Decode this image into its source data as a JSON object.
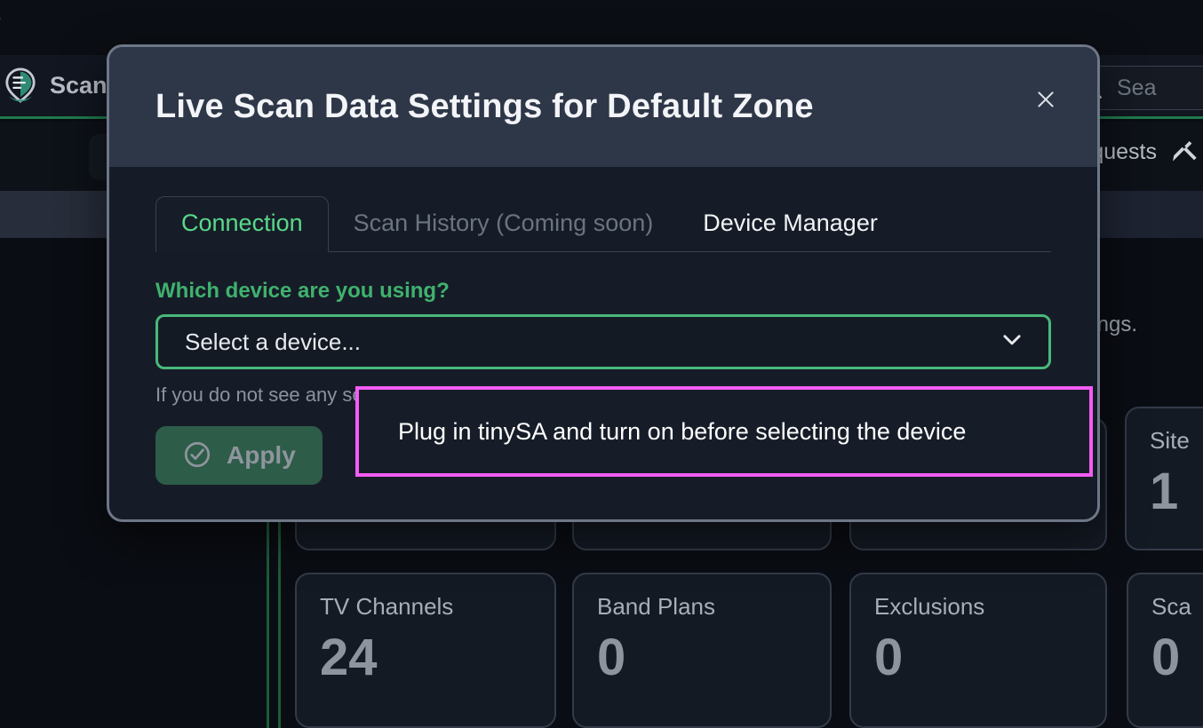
{
  "background": {
    "top_strip_text": "e",
    "brand": {
      "name": "ScanP",
      "logo_icon": "scan-pin-logo-icon"
    },
    "search": {
      "icon": "search-icon",
      "placeholder": "Sea"
    },
    "subnav": {
      "right_label": "quests",
      "right_icon": "tools-icon"
    },
    "body_text": "ngs.",
    "cards_upper": [
      {
        "title": "",
        "value": ""
      },
      {
        "title": "",
        "value": ""
      },
      {
        "title": "",
        "value": ""
      }
    ],
    "card_site": {
      "title": "Site",
      "value": "1"
    },
    "cards_lower": [
      {
        "title": "TV Channels",
        "value": "24"
      },
      {
        "title": "Band Plans",
        "value": "0"
      },
      {
        "title": "Exclusions",
        "value": "0"
      },
      {
        "title": "Sca",
        "value": "0"
      }
    ]
  },
  "modal": {
    "title": "Live Scan Data Settings for Default Zone",
    "close_icon": "close-icon",
    "tabs": [
      {
        "label": "Connection",
        "state": "active"
      },
      {
        "label": "Scan History (Coming soon)",
        "state": "disabled"
      },
      {
        "label": "Device Manager",
        "state": "plain"
      }
    ],
    "field": {
      "label": "Which device are you using?",
      "selected_value": "Select a device...",
      "chevron_icon": "chevron-down-icon",
      "helper": "If you do not see any selectable options, please register a new device to your account."
    },
    "apply": {
      "label": "Apply",
      "icon": "circle-check-icon"
    },
    "callout": {
      "text": "Plug in tinySA and turn on before selecting the device"
    }
  },
  "colors": {
    "accent_green": "#49b87b",
    "tab_active_green": "#58d98a",
    "callout_magenta": "#f45cf4",
    "modal_header": "#2e3748",
    "modal_body": "#161c27",
    "page_background": "#0a0d13"
  }
}
